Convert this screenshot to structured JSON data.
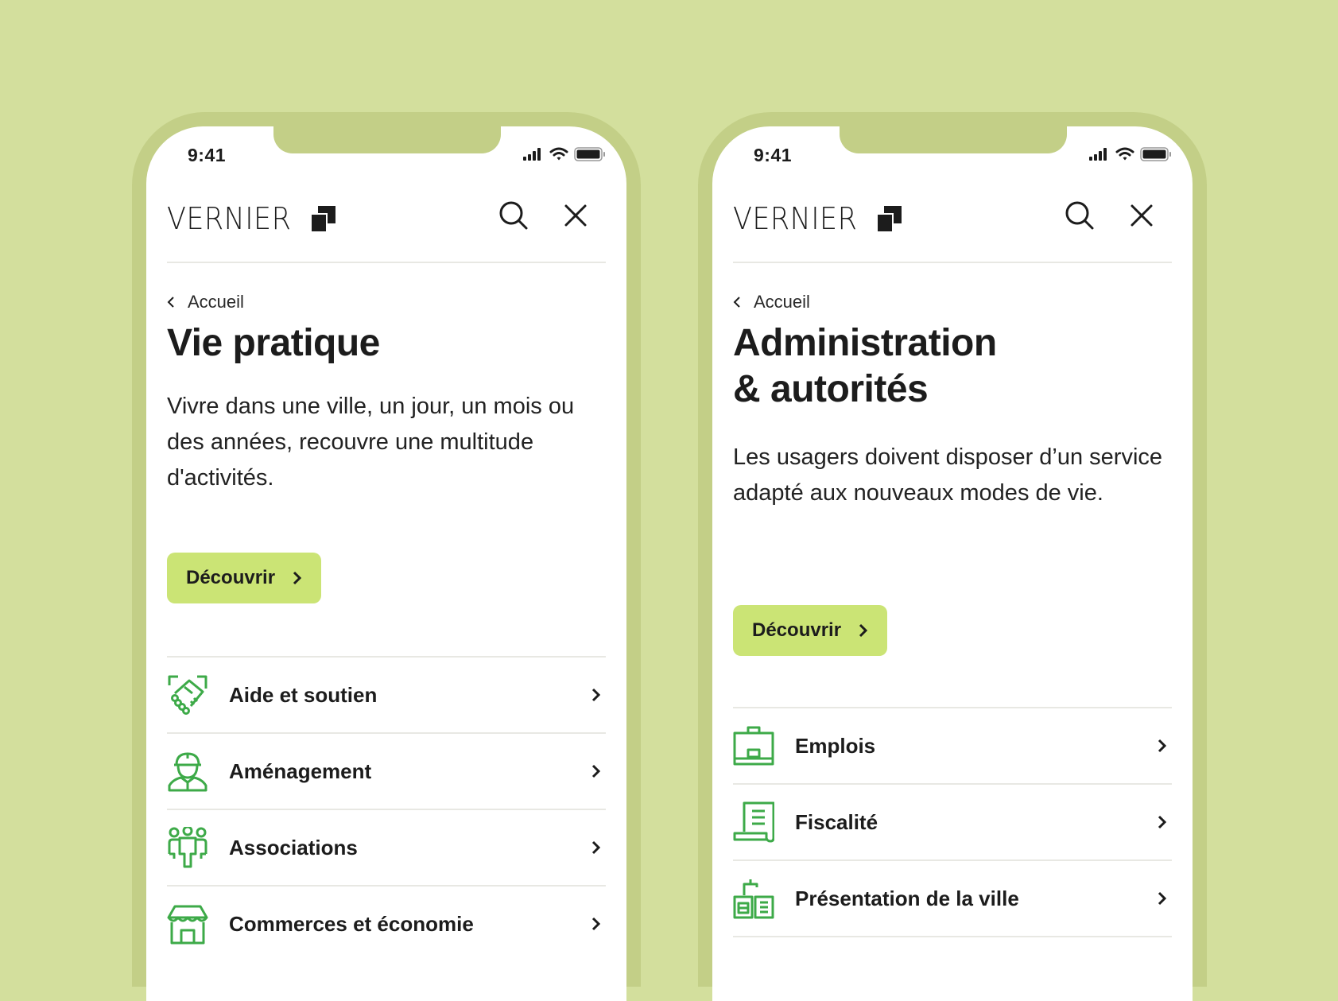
{
  "colors": {
    "background": "#d3df9d",
    "phone_frame": "#c3cf87",
    "accent_button": "#cbe475",
    "icon_green": "#3daa48",
    "text": "#1c1c1c",
    "divider": "#e8e8e3"
  },
  "phones": [
    {
      "status_bar": {
        "time": "9:41",
        "icons": [
          "signal-icon",
          "wifi-icon",
          "battery-icon"
        ]
      },
      "header": {
        "logo_text": "VERNIER",
        "logo_icon": "vernier-squares-logo",
        "search_icon": "search-icon",
        "close_icon": "close-icon"
      },
      "breadcrumb": {
        "label": "Accueil",
        "icon": "chevron-left-icon"
      },
      "title_lines": [
        "Vie pratique"
      ],
      "description": "Vivre dans une ville, un jour, un mois ou des années, recouvre une multitude d'activités.",
      "cta": {
        "label": "Découvrir",
        "icon": "chevron-right-icon"
      },
      "items": [
        {
          "label": "Aide et soutien",
          "icon": "handshake-icon"
        },
        {
          "label": "Aménagement",
          "icon": "worker-helmet-icon"
        },
        {
          "label": "Associations",
          "icon": "group-people-icon"
        },
        {
          "label": "Commerces et économie",
          "icon": "storefront-icon"
        }
      ]
    },
    {
      "status_bar": {
        "time": "9:41",
        "icons": [
          "signal-icon",
          "wifi-icon",
          "battery-icon"
        ]
      },
      "header": {
        "logo_text": "VERNIER",
        "logo_icon": "vernier-squares-logo",
        "search_icon": "search-icon",
        "close_icon": "close-icon"
      },
      "breadcrumb": {
        "label": "Accueil",
        "icon": "chevron-left-icon"
      },
      "title_lines": [
        "Administration",
        "& autorités"
      ],
      "description": "Les usagers doivent disposer d’un service adapté aux nouveaux modes de vie.",
      "cta": {
        "label": "Découvrir",
        "icon": "chevron-right-icon"
      },
      "items": [
        {
          "label": "Emplois",
          "icon": "briefcase-icon"
        },
        {
          "label": "Fiscalité",
          "icon": "tax-document-icon"
        },
        {
          "label": "Présentation de la ville",
          "icon": "city-buildings-icon"
        }
      ]
    }
  ]
}
